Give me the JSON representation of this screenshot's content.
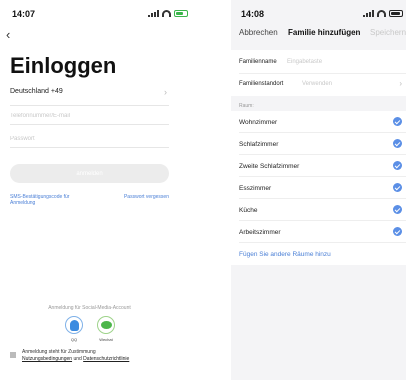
{
  "left": {
    "status": {
      "time": "14:07"
    },
    "back_icon": "chevron-left-icon",
    "title": "Einloggen",
    "country": "Deutschland +49",
    "phone_placeholder": "Telefonnummer/E-mail",
    "password_placeholder": "Passwort",
    "login_label": "anmelden",
    "sms_link": "SMS-Bestätigungscode für Anmeldung",
    "forgot_link": "Passwort vergessen",
    "social_label": "Anmeldung für Social-Media-Account",
    "social": [
      {
        "label": "QQ",
        "icon": "qq-icon",
        "color": "#3b8be0"
      },
      {
        "label": "Wechat",
        "icon": "wechat-icon",
        "color": "#4cb64a"
      }
    ],
    "agreement": {
      "prefix": "Anmeldung steht für Zustimmung",
      "terms": "Nutzungsbedingungen",
      "and": "und",
      "privacy": "Datenschutzrichtlinie"
    }
  },
  "right": {
    "status": {
      "time": "14:08"
    },
    "nav": {
      "cancel": "Abbrechen",
      "title": "Familie hinzufügen",
      "save": "Speichern"
    },
    "family_name_label": "Familienname",
    "family_name_placeholder": "Eingabetaste",
    "location_label": "Familienstandort",
    "location_action": "Verwenden",
    "rooms_header": "Raum:",
    "rooms": [
      {
        "name": "Wohnzimmer",
        "checked": true
      },
      {
        "name": "Schlafzimmer",
        "checked": true
      },
      {
        "name": "Zweite Schlafzimmer",
        "checked": true
      },
      {
        "name": "Esszimmer",
        "checked": true
      },
      {
        "name": "Küche",
        "checked": true
      },
      {
        "name": "Arbeitszimmer",
        "checked": true
      }
    ],
    "add_rooms": "Fügen Sie andere Räume hinzu"
  },
  "colors": {
    "accent": "#5b8fe6",
    "link": "#4a7fd6",
    "battery_green": "#3ab54a"
  }
}
